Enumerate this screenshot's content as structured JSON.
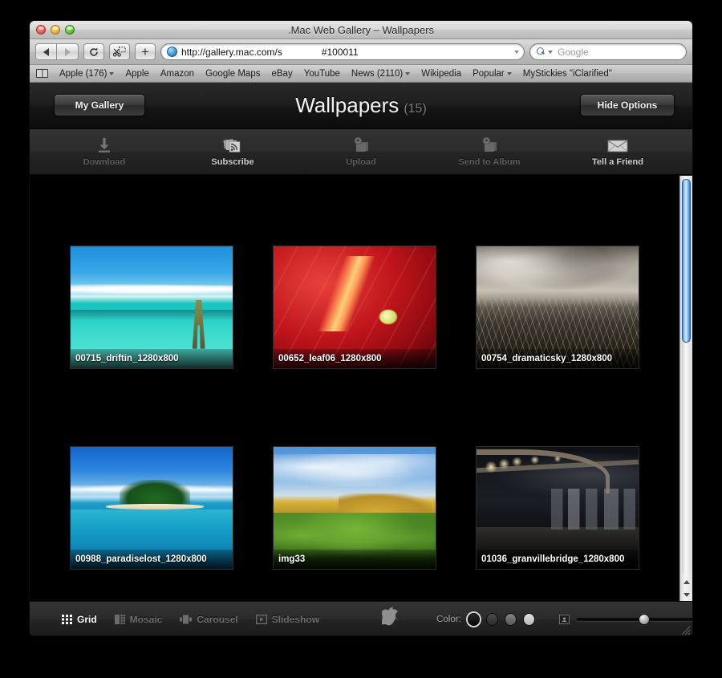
{
  "window": {
    "title": ".Mac Web Gallery – Wallpapers",
    "traffic": {
      "close": "close-button",
      "minimize": "minimize-button",
      "maximize": "maximize-button"
    }
  },
  "browser": {
    "back_label": "Back",
    "forward_label": "Forward",
    "reload_label": "↻",
    "snapback_label": "Snapback",
    "add_label": "+",
    "url": "http://gallery.mac.com/s",
    "url_fragment": "#100011",
    "search_placeholder": "Google",
    "bookmarks": [
      {
        "label": "Apple (176)",
        "has_menu": true
      },
      {
        "label": "Apple",
        "has_menu": false
      },
      {
        "label": "Amazon",
        "has_menu": false
      },
      {
        "label": "Google Maps",
        "has_menu": false
      },
      {
        "label": "eBay",
        "has_menu": false
      },
      {
        "label": "YouTube",
        "has_menu": false
      },
      {
        "label": "News (2110)",
        "has_menu": true
      },
      {
        "label": "Wikipedia",
        "has_menu": false
      },
      {
        "label": "Popular",
        "has_menu": true
      },
      {
        "label": "MyStickies \"iClarified\"",
        "has_menu": false
      }
    ]
  },
  "gallery": {
    "my_gallery_label": "My Gallery",
    "hide_options_label": "Hide Options",
    "album_title": "Wallpapers",
    "album_count": "(15)",
    "actions": [
      {
        "label": "Download",
        "icon": "download-icon",
        "enabled": false
      },
      {
        "label": "Subscribe",
        "icon": "subscribe-rss-icon",
        "enabled": true
      },
      {
        "label": "Upload",
        "icon": "upload-icon",
        "enabled": false
      },
      {
        "label": "Send to Album",
        "icon": "send-to-album-icon",
        "enabled": false
      },
      {
        "label": "Tell a Friend",
        "icon": "envelope-icon",
        "enabled": true
      }
    ],
    "photos": [
      {
        "caption": "00715_driftin_1280x800",
        "art": "p1"
      },
      {
        "caption": "00652_leaf06_1280x800",
        "art": "p2"
      },
      {
        "caption": "00754_dramaticsky_1280x800",
        "art": "p3"
      },
      {
        "caption": "00988_paradiselost_1280x800",
        "art": "p4"
      },
      {
        "caption": "img33",
        "art": "p5"
      },
      {
        "caption": "01036_granvillebridge_1280x800",
        "art": "p6"
      }
    ]
  },
  "footer": {
    "modes": [
      {
        "label": "Grid",
        "icon": "grid-view-icon",
        "active": true
      },
      {
        "label": "Mosaic",
        "icon": "mosaic-view-icon",
        "active": false
      },
      {
        "label": "Carousel",
        "icon": "carousel-view-icon",
        "active": false
      },
      {
        "label": "Slideshow",
        "icon": "slideshow-play-icon",
        "active": false
      }
    ],
    "apple_logo": "apple-logo-icon",
    "color_label": "Color:",
    "color_swatches": [
      {
        "hex": "#0a0a0a",
        "selected": true
      },
      {
        "hex": "#39393a",
        "selected": false
      },
      {
        "hex": "#6e6e70",
        "selected": false
      },
      {
        "hex": "#c8c8c8",
        "selected": false
      }
    ],
    "size_small_icon": "small-thumbnail-icon",
    "size_large_icon": "large-thumbnail-icon",
    "size_slider_value": 58
  },
  "scrollbar": {
    "thumb_position_pct": 2,
    "up_arrow": "scroll-up-arrow",
    "down_arrow": "scroll-down-arrow"
  }
}
